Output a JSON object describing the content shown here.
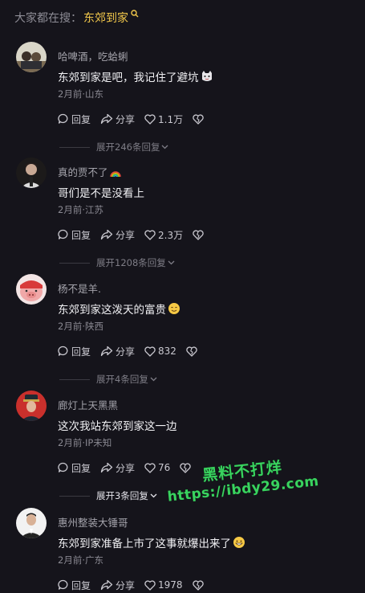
{
  "search": {
    "prefix": "大家都在搜：",
    "keyword": "东郊到家"
  },
  "comments": [
    {
      "username": "哈啤酒，吃蛤蜊",
      "text": "东郊到家是吧，我记住了避坑",
      "meta": "2月前·山东",
      "reply_label": "回复",
      "share_label": "分享",
      "likes": "1.1万",
      "expand": "展开246条回复"
    },
    {
      "username": "真的贾不了",
      "text": "哥们是不是没看上",
      "meta": "2月前·江苏",
      "reply_label": "回复",
      "share_label": "分享",
      "likes": "2.3万",
      "expand": "展开1208条回复"
    },
    {
      "username": "杨不是羊.",
      "text": "东郊到家这泼天的富贵",
      "meta": "2月前·陕西",
      "reply_label": "回复",
      "share_label": "分享",
      "likes": "832",
      "expand": "展开4条回复"
    },
    {
      "username": "廊灯上天黑黑",
      "text": "这次我站东郊到家这一边",
      "meta": "2月前·IP未知",
      "reply_label": "回复",
      "share_label": "分享",
      "likes": "76",
      "expand": "展开3条回复"
    },
    {
      "username": "惠州整装大锤哥",
      "text": "东郊到家准备上市了这事就爆出来了",
      "meta": "2月前·广东",
      "reply_label": "回复",
      "share_label": "分享",
      "likes": "1978"
    }
  ],
  "watermark": {
    "line1": "黑料不打烊",
    "line2": "https://ibdy29.com"
  },
  "colors": {
    "background": "#15141b",
    "keyword": "#f2c84b",
    "watermark": "#39d35f"
  }
}
